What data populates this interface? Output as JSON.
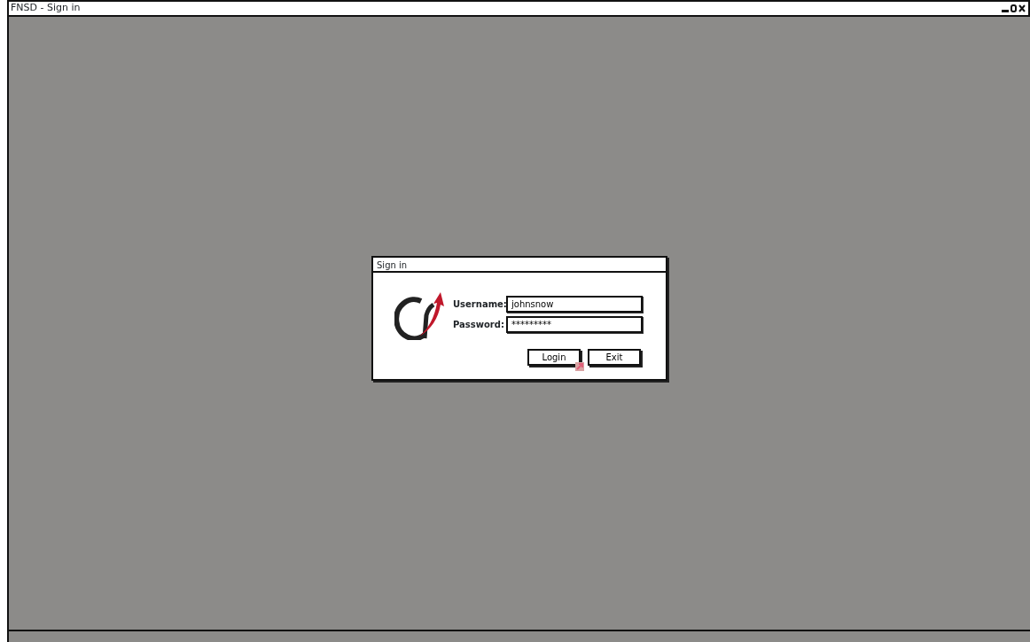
{
  "window": {
    "title": "FNSD - Sign in"
  },
  "dialog": {
    "title": "Sign in",
    "fields": [
      {
        "label": "Username:",
        "value": "johnsnow"
      },
      {
        "label": "Password:",
        "value": "*********"
      }
    ],
    "buttons": [
      "Login",
      "Exit"
    ]
  }
}
